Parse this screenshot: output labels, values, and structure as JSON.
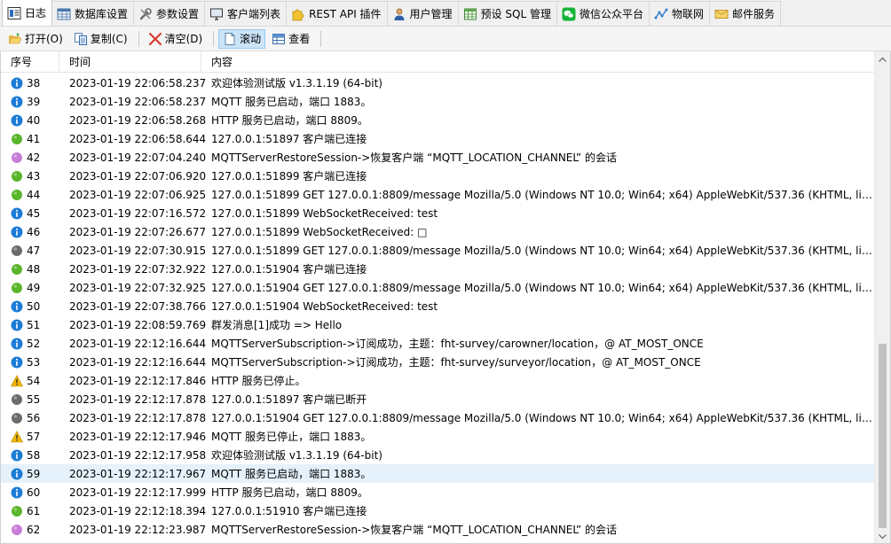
{
  "tabs": [
    {
      "label": "日志",
      "icon": "log-icon",
      "active": true
    },
    {
      "label": "数据库设置",
      "icon": "database-icon"
    },
    {
      "label": "参数设置",
      "icon": "tools-icon"
    },
    {
      "label": "客户端列表",
      "icon": "monitor-icon"
    },
    {
      "label": "REST API 插件",
      "icon": "puzzle-icon"
    },
    {
      "label": "用户管理",
      "icon": "user-icon"
    },
    {
      "label": "预设 SQL 管理",
      "icon": "table-icon"
    },
    {
      "label": "微信公众平台",
      "icon": "wechat-icon"
    },
    {
      "label": "物联网",
      "icon": "iot-icon"
    },
    {
      "label": "邮件服务",
      "icon": "mail-icon"
    }
  ],
  "toolbar": {
    "open_label": "打开(O)",
    "copy_label": "复制(C)",
    "clear_label": "清空(D)",
    "scroll_label": "滚动",
    "view_label": "查看"
  },
  "columns": {
    "seq": "序号",
    "time": "时间",
    "content": "内容"
  },
  "colors": {
    "info": "#1c7cd5",
    "success": "#59b52a",
    "session": "#c87ed8",
    "neutral": "#6b6b6b",
    "warning": "#f2b705",
    "selected_row": "#e5f1fb"
  },
  "rows": [
    {
      "seq": "38",
      "time": "2023-01-19 22:06:58.237",
      "content": "欢迎体验测试版 v1.3.1.19 (64-bit)",
      "level": "info"
    },
    {
      "seq": "39",
      "time": "2023-01-19 22:06:58.237",
      "content": "MQTT 服务已启动，端口 1883。",
      "level": "info"
    },
    {
      "seq": "40",
      "time": "2023-01-19 22:06:58.268",
      "content": "HTTP 服务已启动，端口 8809。",
      "level": "info"
    },
    {
      "seq": "41",
      "time": "2023-01-19 22:06:58.644",
      "content": "127.0.0.1:51897    客户端已连接",
      "level": "success"
    },
    {
      "seq": "42",
      "time": "2023-01-19 22:07:04.240",
      "content": "MQTTServerRestoreSession->恢复客户端 “MQTT_LOCATION_CHANNEL” 的会话",
      "level": "session"
    },
    {
      "seq": "43",
      "time": "2023-01-19 22:07:06.920",
      "content": "127.0.0.1:51899    客户端已连接",
      "level": "success"
    },
    {
      "seq": "44",
      "time": "2023-01-19 22:07:06.925",
      "content": "127.0.0.1:51899 GET 127.0.0.1:8809/message Mozilla/5.0 (Windows NT 10.0; Win64; x64) AppleWebKit/537.36 (KHTML, like G...",
      "level": "success"
    },
    {
      "seq": "45",
      "time": "2023-01-19 22:07:16.572",
      "content": "127.0.0.1:51899 WebSocketReceived: test",
      "level": "info"
    },
    {
      "seq": "46",
      "time": "2023-01-19 22:07:26.677",
      "content": "127.0.0.1:51899 WebSocketReceived: □",
      "level": "info"
    },
    {
      "seq": "47",
      "time": "2023-01-19 22:07:30.915",
      "content": "127.0.0.1:51899 GET 127.0.0.1:8809/message Mozilla/5.0 (Windows NT 10.0; Win64; x64) AppleWebKit/537.36 (KHTML, like G...",
      "level": "neutral"
    },
    {
      "seq": "48",
      "time": "2023-01-19 22:07:32.922",
      "content": "127.0.0.1:51904    客户端已连接",
      "level": "success"
    },
    {
      "seq": "49",
      "time": "2023-01-19 22:07:32.925",
      "content": "127.0.0.1:51904 GET 127.0.0.1:8809/message Mozilla/5.0 (Windows NT 10.0; Win64; x64) AppleWebKit/537.36 (KHTML, like G...",
      "level": "success"
    },
    {
      "seq": "50",
      "time": "2023-01-19 22:07:38.766",
      "content": "127.0.0.1:51904 WebSocketReceived: test",
      "level": "info"
    },
    {
      "seq": "51",
      "time": "2023-01-19 22:08:59.769",
      "content": "群发消息[1]成功 => Hello",
      "level": "info"
    },
    {
      "seq": "52",
      "time": "2023-01-19 22:12:16.644",
      "content": "MQTTServerSubscription->订阅成功，主题：fht-survey/carowner/location，@ AT_MOST_ONCE",
      "level": "info"
    },
    {
      "seq": "53",
      "time": "2023-01-19 22:12:16.644",
      "content": "MQTTServerSubscription->订阅成功，主题：fht-survey/surveyor/location，@ AT_MOST_ONCE",
      "level": "info"
    },
    {
      "seq": "54",
      "time": "2023-01-19 22:12:17.846",
      "content": "HTTP 服务已停止。",
      "level": "warning"
    },
    {
      "seq": "55",
      "time": "2023-01-19 22:12:17.878",
      "content": "127.0.0.1:51897    客户端已断开",
      "level": "neutral"
    },
    {
      "seq": "56",
      "time": "2023-01-19 22:12:17.878",
      "content": "127.0.0.1:51904 GET 127.0.0.1:8809/message Mozilla/5.0 (Windows NT 10.0; Win64; x64) AppleWebKit/537.36 (KHTML, like G...",
      "level": "neutral"
    },
    {
      "seq": "57",
      "time": "2023-01-19 22:12:17.946",
      "content": "MQTT 服务已停止，端口 1883。",
      "level": "warning"
    },
    {
      "seq": "58",
      "time": "2023-01-19 22:12:17.958",
      "content": "欢迎体验测试版 v1.3.1.19 (64-bit)",
      "level": "info"
    },
    {
      "seq": "59",
      "time": "2023-01-19 22:12:17.967",
      "content": "MQTT 服务已启动，端口 1883。",
      "level": "info",
      "selected": true
    },
    {
      "seq": "60",
      "time": "2023-01-19 22:12:17.999",
      "content": "HTTP 服务已启动，端口 8809。",
      "level": "info"
    },
    {
      "seq": "61",
      "time": "2023-01-19 22:12:18.394",
      "content": "127.0.0.1:51910    客户端已连接",
      "level": "success"
    },
    {
      "seq": "62",
      "time": "2023-01-19 22:12:23.987",
      "content": "MQTTServerRestoreSession->恢复客户端 “MQTT_LOCATION_CHANNEL” 的会话",
      "level": "session"
    }
  ]
}
